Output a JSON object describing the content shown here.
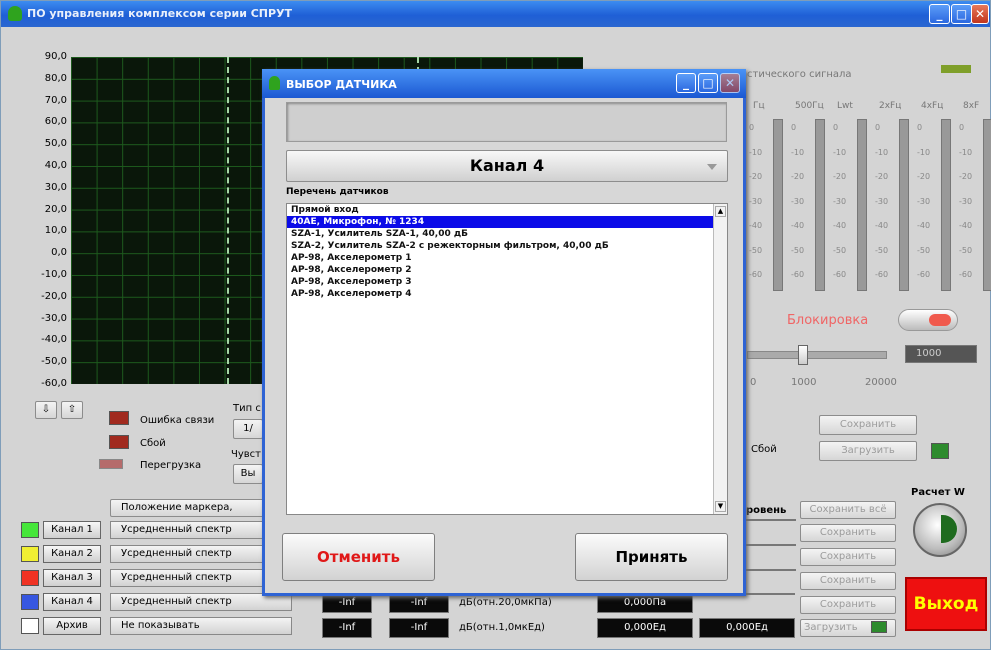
{
  "window": {
    "title": "ПО управления комплексом серии СПРУТ"
  },
  "chart_data": {
    "type": "line",
    "ylabels": [
      "90,0",
      "80,0",
      "70,0",
      "60,0",
      "50,0",
      "40,0",
      "30,0",
      "20,0",
      "10,0",
      "0,0",
      "-10,0",
      "-20,0",
      "-30,0",
      "-40,0",
      "-50,0",
      "-60,0"
    ],
    "ylim": [
      -60,
      90
    ],
    "grid": true,
    "series": []
  },
  "right_panel": {
    "title": "стического сигнала",
    "labels": [
      "Гц",
      "500Гц",
      "Lwt",
      "2xFц",
      "4xFц",
      "8xF"
    ],
    "ticks": [
      "0",
      "-10",
      "-20",
      "-30",
      "-40",
      "-50",
      "-60"
    ],
    "block_label": "Блокировка",
    "slider_value": "1000",
    "scale": [
      "0",
      "1000",
      "20000"
    ],
    "save": "Сохранить",
    "load": "Загрузить",
    "fail": "Сбой"
  },
  "left_controls": {
    "comm_error": "Ошибка связи",
    "fail": "Сбой",
    "overload": "Перегрузка",
    "type": "Тип с",
    "ratio": "1/",
    "sens": "Чувст",
    "val": "Вы"
  },
  "marker_pos": "Положение маркера,",
  "channels": [
    {
      "name": "Канал 1",
      "mode": "Усредненный спектр",
      "color": "#46e63a"
    },
    {
      "name": "Канал 2",
      "mode": "Усредненный спектр",
      "color": "#f0ef32"
    },
    {
      "name": "Канал 3",
      "mode": "Усредненный спектр",
      "color": "#f03324"
    },
    {
      "name": "Канал 4",
      "mode": "Усредненный спектр",
      "color": "#3757e0"
    },
    {
      "name": "Архив",
      "mode": "Не показывать",
      "color": "#ffffff"
    }
  ],
  "bottom": {
    "inf1": "-Inf",
    "inf2": "-Inf",
    "unit1": "дБ(отн.20,0мкПа)",
    "pa": "0,000Па",
    "inf3": "-Inf",
    "inf4": "-Inf",
    "unit2": "дБ(отн.1,0мкЕд)",
    "ed1": "0,000Ед",
    "ed2": "0,000Ед",
    "level": "ровень",
    "save_all": "Сохранить всё",
    "save": "Сохранить",
    "load": "Загрузить",
    "calc": "Расчет W",
    "exit": "Выход"
  },
  "dialog": {
    "title": "ВЫБОР ДАТЧИКА",
    "channel": "Канал 4",
    "list_label": "Перечень датчиков",
    "items": [
      "Прямой вход",
      "40AE, Микрофон, № 1234",
      "SZA-1, Усилитель SZA-1, 40,00 дБ",
      "SZA-2, Усилитель SZA-2 с режекторным фильтром, 40,00 дБ",
      "AP-98, Акселерометр 1",
      "AP-98, Акселерометр 2",
      "AP-98, Акселерометр 3",
      "AP-98, Акселерометр 4"
    ],
    "selected": 1,
    "cancel": "Отменить",
    "accept": "Принять"
  }
}
